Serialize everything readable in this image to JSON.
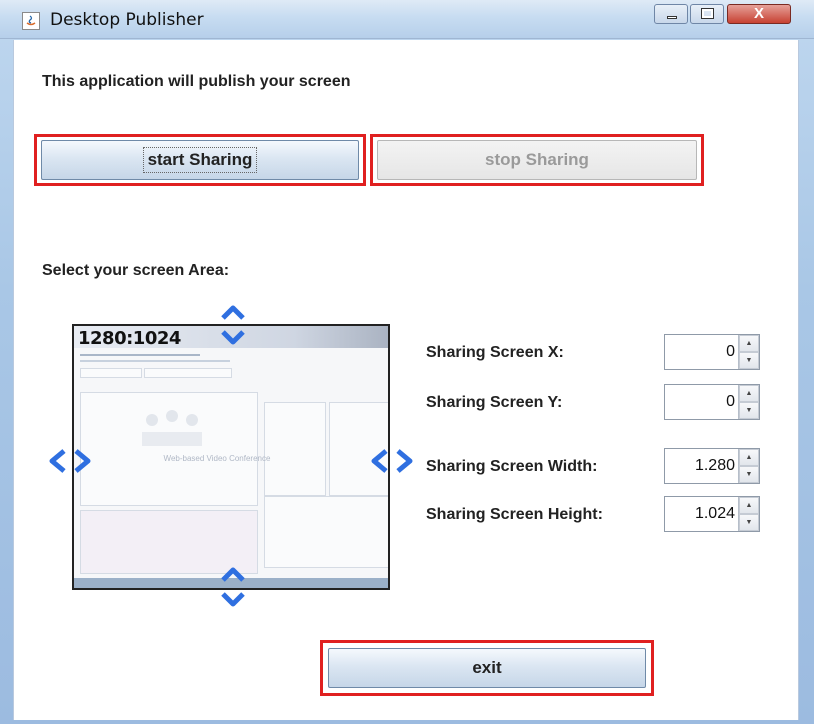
{
  "window": {
    "title": "Desktop Publisher",
    "close_glyph": "X"
  },
  "intro_text": "This application will publish your screen",
  "buttons": {
    "start": "start Sharing",
    "stop": "stop Sharing",
    "exit": "exit"
  },
  "area": {
    "label": "Select your screen Area:",
    "resolution": "1280:1024",
    "preview_caption": "Web-based Video Conference"
  },
  "fields": [
    {
      "label": "Sharing Screen X:",
      "value": "0"
    },
    {
      "label": "Sharing Screen Y:",
      "value": "0"
    },
    {
      "label": "Sharing Screen Width:",
      "value": "1.280"
    },
    {
      "label": "Sharing Screen Height:",
      "value": "1.024"
    }
  ],
  "icons": {
    "app": "java-icon",
    "minimize": "minimize-icon",
    "maximize": "maximize-icon",
    "close": "close-icon",
    "arrows": [
      "arrow-up-down-icon",
      "arrow-left-right-icon"
    ]
  },
  "colors": {
    "highlight_red": "#e02020",
    "arrow_blue": "#2f6fe0"
  }
}
